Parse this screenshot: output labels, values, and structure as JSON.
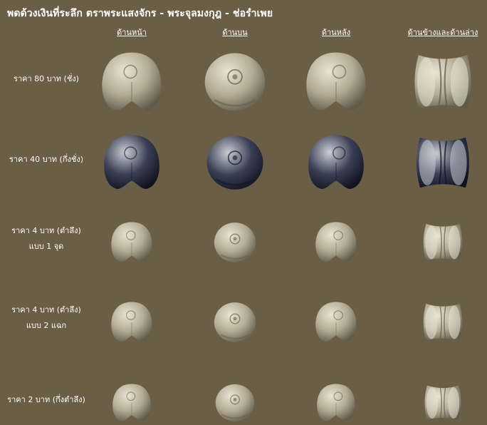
{
  "title": "พดด้วงเงินที่ระลึก ตราพระแสงจักร - พระจุลมงกุฎ - ช่อรำเพย",
  "columns": [
    "ด้านหน้า",
    "ด้านบน",
    "ด้านหลัง",
    "ด้านข้างและด้านล่าง"
  ],
  "rows": [
    {
      "label_line1": "ราคา 80 บาท (ชั่ง)",
      "label_line2": "",
      "tone": "silver"
    },
    {
      "label_line1": "ราคา 40 บาท (กึ่งชั่ง)",
      "label_line2": "",
      "tone": "dark"
    },
    {
      "label_line1": "ราคา 4 บาท (ตำลึง)",
      "label_line2": "แบบ 1 จุด",
      "tone": "silver"
    },
    {
      "label_line1": "ราคา 4 บาท (ตำลึง)",
      "label_line2": "แบบ 2 แฉก",
      "tone": "silver"
    },
    {
      "label_line1": "ราคา 2 บาท (กึ่งตำลึง)",
      "label_line2": "",
      "tone": "silver"
    }
  ],
  "colors": {
    "background": "#6b5e47",
    "silver_light": "#e9e4d4",
    "silver_mid": "#b3ab94",
    "silver_dark": "#5f5a4c",
    "dark_light": "#c9cfd3",
    "dark_mid": "#3a3f55",
    "dark_dark": "#11131f"
  }
}
